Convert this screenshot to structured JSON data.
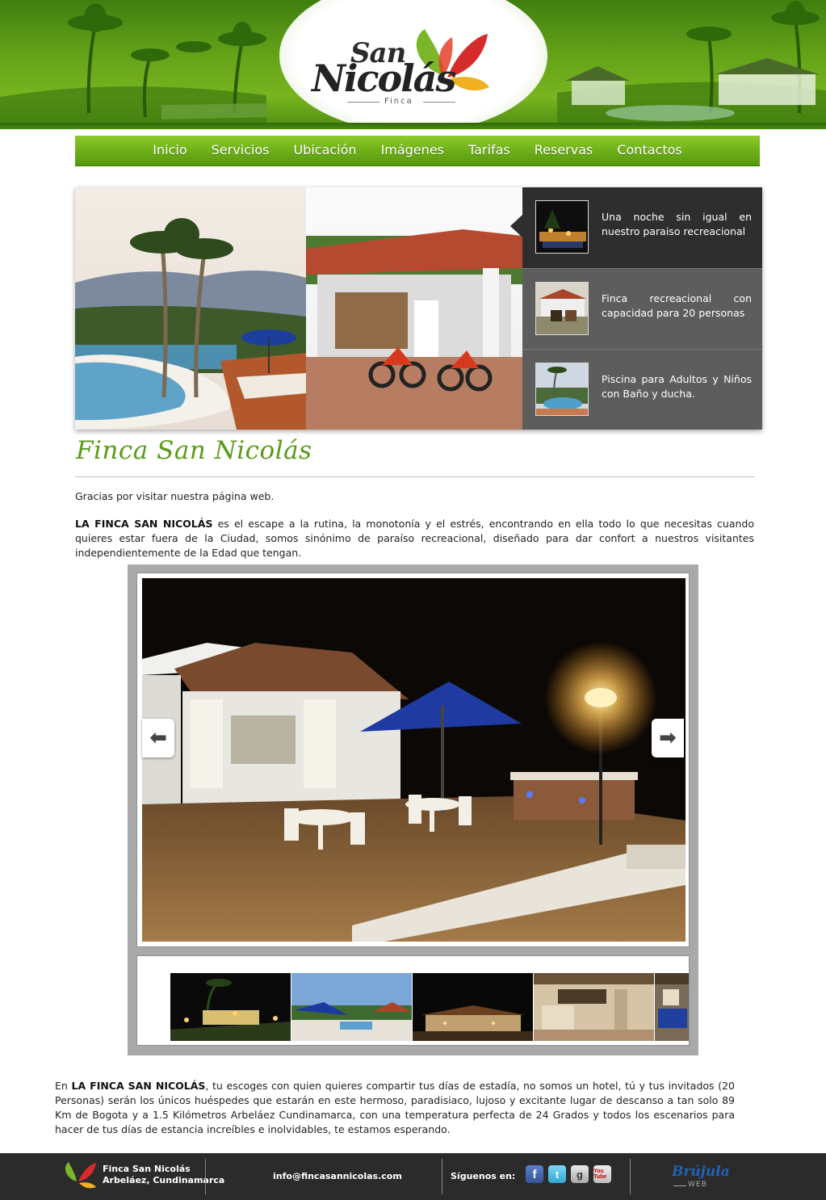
{
  "header": {
    "logo_san": "San",
    "logo_nicolas": "Nicolás",
    "logo_finca": "Finca"
  },
  "nav": {
    "items": [
      "Inicio",
      "Servicios",
      "Ubicación",
      "Imágenes",
      "Tarifas",
      "Reservas",
      "Contactos"
    ]
  },
  "feature": {
    "tabs": [
      {
        "text": "Una noche sin igual en nuestro paraiso recreacional",
        "active": true
      },
      {
        "text": "Finca recreacional con capacidad para 20 personas",
        "active": false
      },
      {
        "text": "Piscina para Adultos y Niños con Baño y ducha.",
        "active": false
      }
    ]
  },
  "main": {
    "title": "Finca San Nicolás",
    "thanks": "Gracias por visitar nuestra página web.",
    "intro_bold": "LA FINCA SAN NICOLÁS",
    "intro_rest": " es el escape a la rutina, la monotonía y el estrés, encontrando en ella todo lo que necesitas cuando quieres estar fuera de la Ciudad, somos sinónimo de paraíso recreacional, diseñado para dar confort a nuestros visitantes independientemente de la Edad que tengan.",
    "bottom_pre": "En ",
    "bottom_bold": "LA FINCA SAN NICOLÁS",
    "bottom_rest": ", tu escoges con quien quieres compartir tus días de estadía, no somos un hotel, tú y tus invitados (20 Personas) serán los únicos huéspedes que estarán en este hermoso, paradisiaco, lujoso y excitante lugar de descanso a tan solo 89 Km de Bogota y a 1.5 Kilómetros Arbeláez Cundinamarca, con una temperatura perfecta de 24 Grados y todos los escenarios para hacer de tus días de estancia increíbles e inolvidables, te estamos esperando."
  },
  "gallery": {
    "prev_icon": "arrow-left-icon",
    "next_icon": "arrow-right-icon",
    "thumb_count": 5
  },
  "footer": {
    "company_name": "Finca San Nicolás",
    "company_location": "Arbeláez, Cundinamarca",
    "email": "info@fincasannicolas.com",
    "follow_label": "Síguenos en:",
    "social": [
      "facebook-icon",
      "twitter-icon",
      "google-icon",
      "youtube-icon"
    ],
    "social_glyphs": {
      "facebook": "f",
      "twitter": "t",
      "google": "g",
      "youtube": "You Tube"
    },
    "brand": "Brújula",
    "brand_sub": "WEB"
  },
  "colors": {
    "brand_green": "#6cae17",
    "title_green": "#5a9a18",
    "dark_panel": "#2e2e2e",
    "footer_bg": "#2b2b2b"
  }
}
